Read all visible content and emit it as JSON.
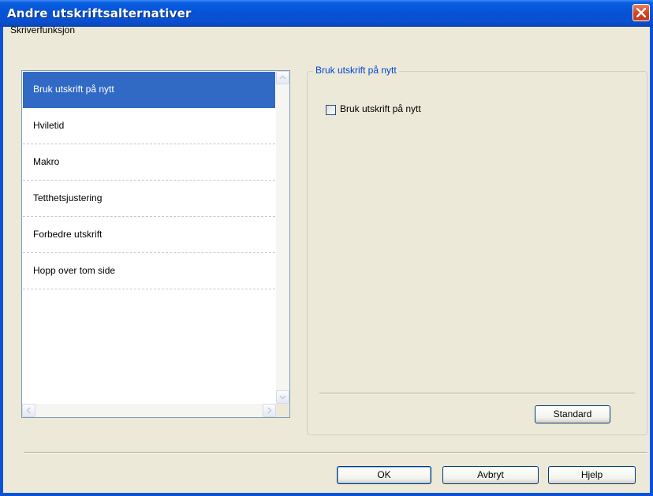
{
  "window": {
    "title": "Andre utskriftsalternativer"
  },
  "section": {
    "label": "Skriverfunksjon"
  },
  "list": {
    "items": [
      {
        "label": "Bruk utskrift på nytt",
        "selected": true
      },
      {
        "label": "Hviletid",
        "selected": false
      },
      {
        "label": "Makro",
        "selected": false
      },
      {
        "label": "Tetthetsjustering",
        "selected": false
      },
      {
        "label": "Forbedre utskrift",
        "selected": false
      },
      {
        "label": "Hopp over tom side",
        "selected": false
      }
    ]
  },
  "panel": {
    "title": "Bruk utskrift på nytt",
    "checkbox_label": "Bruk utskrift på nytt",
    "checkbox_checked": false,
    "standard_label": "Standard"
  },
  "buttons": {
    "ok": "OK",
    "cancel": "Avbryt",
    "help": "Hjelp"
  },
  "colors": {
    "titlebar": "#0553d6",
    "selection": "#316ac5",
    "group_title": "#0046d5",
    "dialog_bg": "#ece9d8"
  }
}
